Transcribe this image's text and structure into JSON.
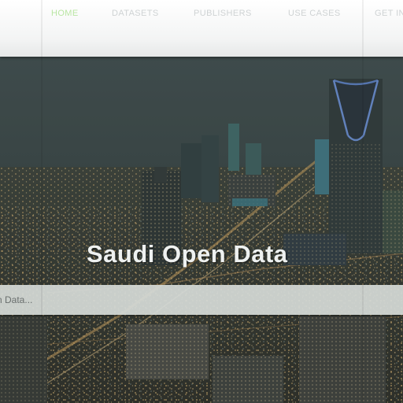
{
  "nav": {
    "items": [
      {
        "label": "HOME",
        "active": true
      },
      {
        "label": "DATASETS",
        "active": false
      },
      {
        "label": "PUBLISHERS",
        "active": false
      },
      {
        "label": "USE CASES",
        "active": false
      },
      {
        "label": "GET IN",
        "active": false
      }
    ],
    "colors": {
      "active": "#b9e6a3",
      "inactive": "#cfd3d4"
    }
  },
  "hero": {
    "title": "Saudi Open Data",
    "background": "night-city-skyline-image"
  },
  "search": {
    "placeholder": "n Data..."
  }
}
